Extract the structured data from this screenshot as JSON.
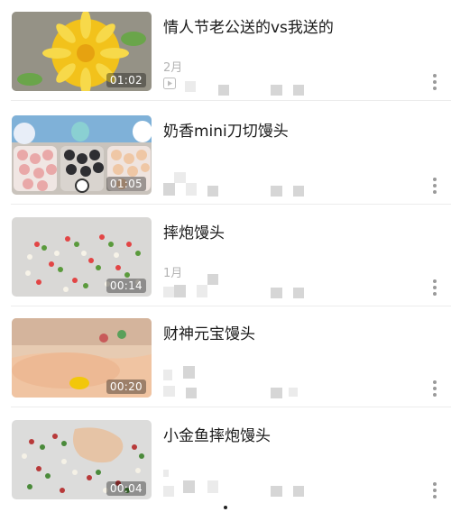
{
  "videos": [
    {
      "title": "情人节老公送的vs我送的",
      "duration": "01:02",
      "meta": "2月",
      "thumb": "flower"
    },
    {
      "title": "奶香mini刀切馒头",
      "duration": "01:05",
      "meta": "",
      "thumb": "buns"
    },
    {
      "title": "摔炮馒头",
      "duration": "00:14",
      "meta": "1月",
      "thumb": "dots"
    },
    {
      "title": "财神元宝馒头",
      "duration": "00:20",
      "meta": "",
      "thumb": "hand"
    },
    {
      "title": "小金鱼摔炮馒头",
      "duration": "00:04",
      "meta": "",
      "thumb": "dots2"
    }
  ],
  "icons": {
    "play": "play-icon",
    "more": "more-vertical-icon"
  }
}
